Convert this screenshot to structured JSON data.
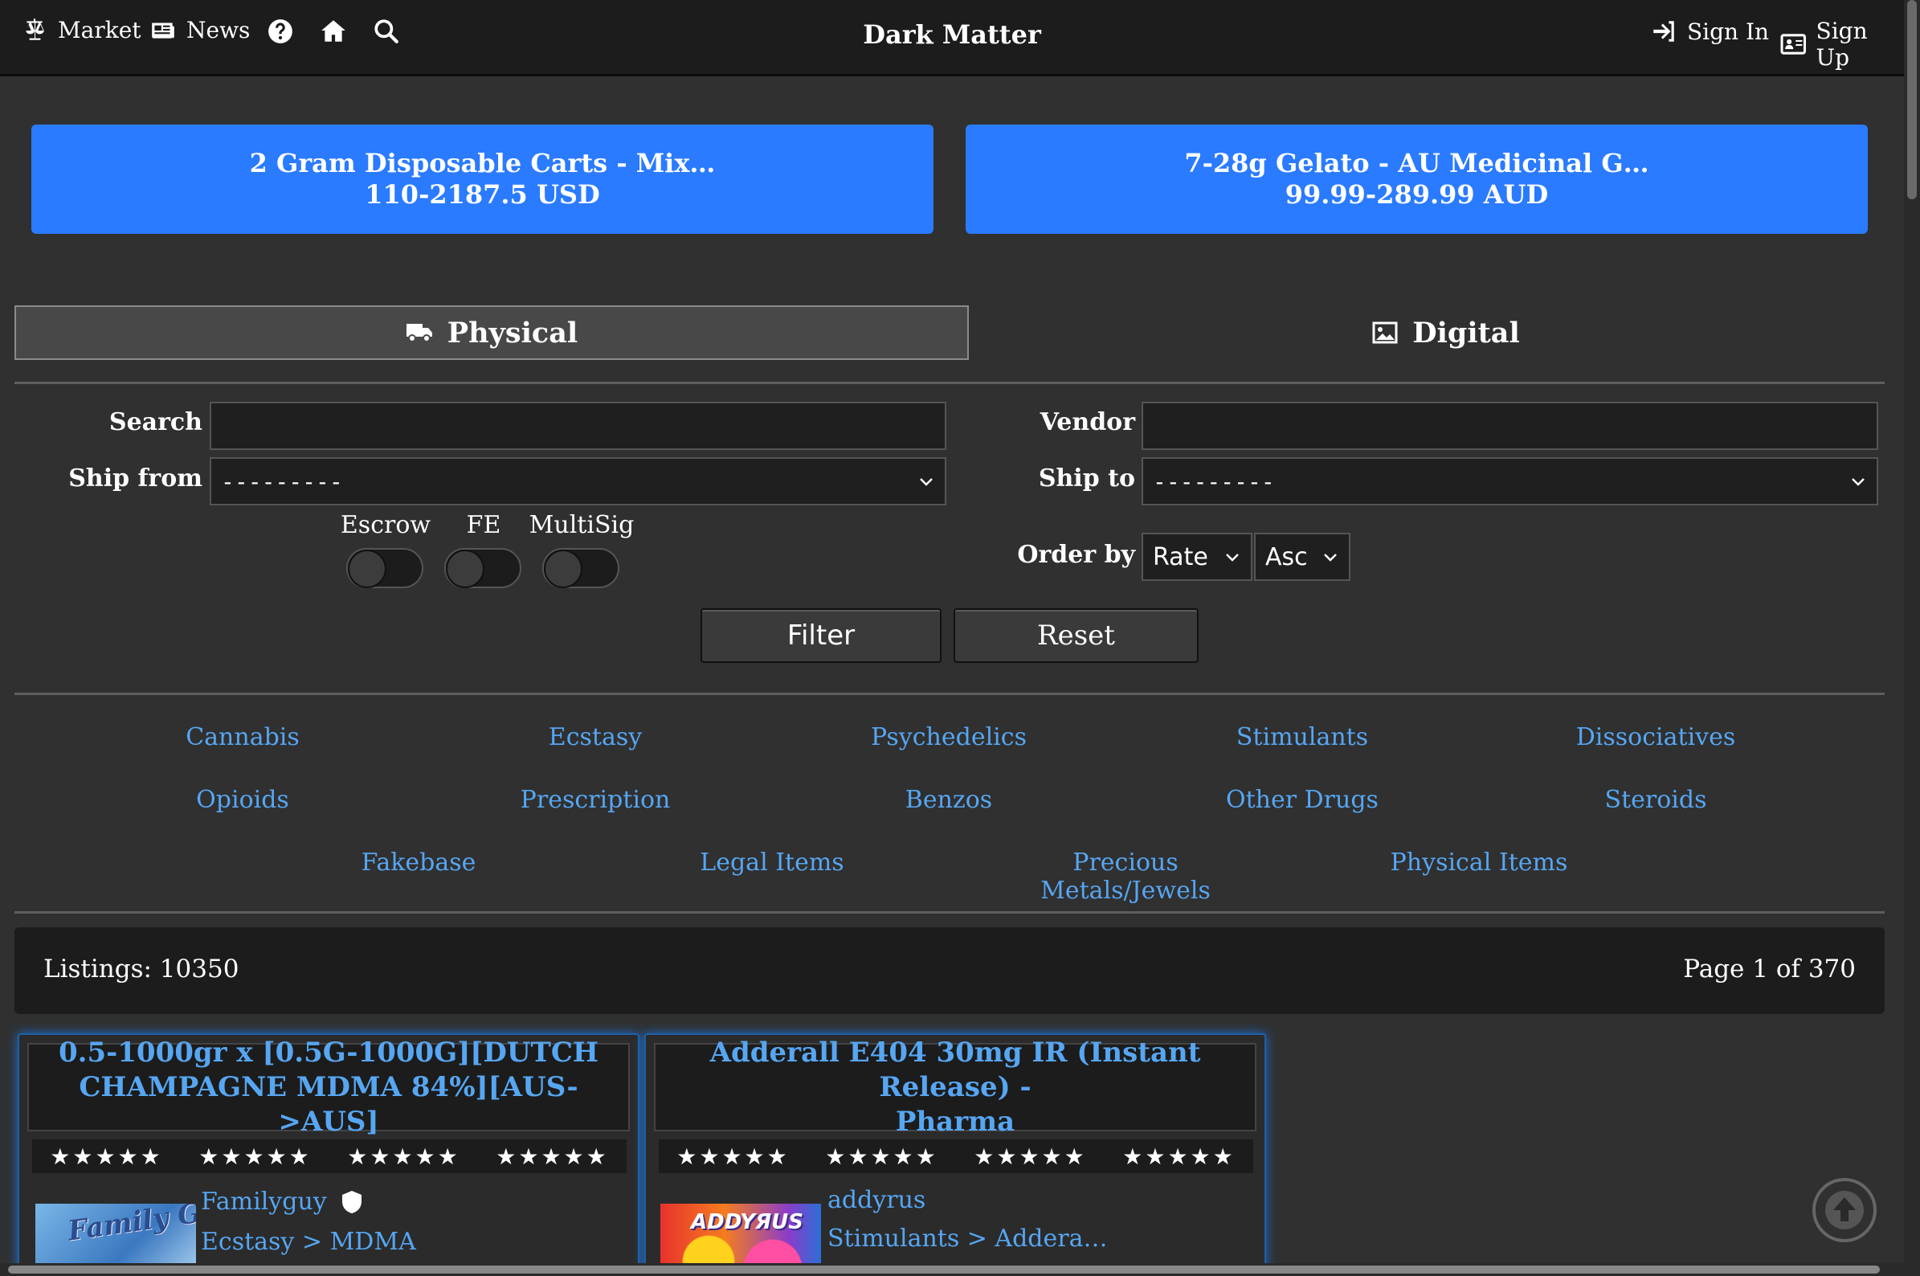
{
  "nav": {
    "market": "Market",
    "news": "News",
    "title": "Dark Matter",
    "sign_in": "Sign In",
    "sign_up": "Sign Up"
  },
  "featured": [
    {
      "title": "2 Gram Disposable Carts - Mix…",
      "price": "110-2187.5 USD"
    },
    {
      "title": "7-28g Gelato - AU Medicinal G…",
      "price": "99.99-289.99 AUD"
    }
  ],
  "tabs": {
    "physical": "Physical",
    "digital": "Digital"
  },
  "filters": {
    "search_label": "Search",
    "search_value": "",
    "vendor_label": "Vendor",
    "vendor_value": "",
    "ship_from_label": "Ship from",
    "ship_from_value": "---------",
    "ship_to_label": "Ship to",
    "ship_to_value": "---------",
    "escrow_label": "Escrow",
    "fe_label": "FE",
    "multisig_label": "MultiSig",
    "order_by_label": "Order by",
    "order_by_value": "Rate",
    "order_dir_value": "Asc",
    "filter_button": "Filter",
    "reset_button": "Reset"
  },
  "categories": [
    "Cannabis",
    "Ecstasy",
    "Psychedelics",
    "Stimulants",
    "Dissociatives",
    "Opioids",
    "Prescription",
    "Benzos",
    "Other Drugs",
    "Steroids",
    "Fakebase",
    "Legal Items",
    "Precious Metals/Jewels",
    "Physical Items"
  ],
  "listings": {
    "count_text": "Listings: 10350",
    "page_text": "Page 1 of 370"
  },
  "cards": [
    {
      "title_line1": "0.5-1000gr x [0.5G-1000G][DUTCH",
      "title_line2": "CHAMPAGNE MDMA 84%][AUS->AUS]",
      "rating_groups": [
        "★★★★★",
        "★★★★★",
        "★★★★★",
        "★★★★★"
      ],
      "vendor": "Familyguy",
      "category": "Ecstasy > MDMA",
      "thumb_text": "Family Guy"
    },
    {
      "title_line1": "Adderall E404 30mg IR (Instant Release) -",
      "title_line2": "Pharma",
      "rating_groups": [
        "★★★★★",
        "★★★★★",
        "★★★★★",
        "★★★★★"
      ],
      "vendor": "addyrus",
      "category": "Stimulants > Addera…",
      "thumb_text": "ADDYЯUS"
    }
  ],
  "colors": {
    "accent_blue": "#2a7bff",
    "link_blue": "#56a6f2",
    "background": "#303030"
  }
}
